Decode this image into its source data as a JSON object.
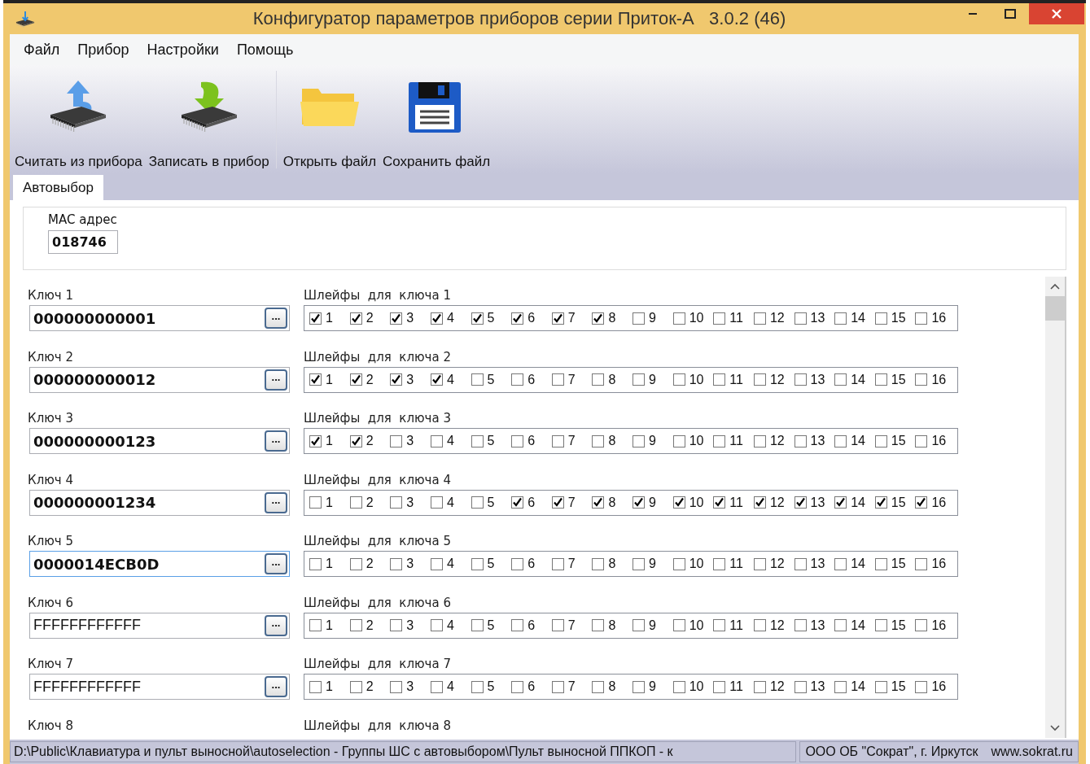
{
  "window": {
    "title": "Конфигуратор параметров приборов серии Приток-А   3.0.2 (46)"
  },
  "menu": [
    "Файл",
    "Прибор",
    "Настройки",
    "Помощь"
  ],
  "toolbar": [
    {
      "kind": "read",
      "label": "Считать из прибора"
    },
    {
      "kind": "write",
      "label": "Записать в прибор"
    },
    {
      "kind": "open",
      "label": "Открыть файл"
    },
    {
      "kind": "save",
      "label": "Сохранить файл"
    }
  ],
  "tabs": [
    {
      "label": "Автовыбор",
      "selected": true
    }
  ],
  "mac": {
    "label": "MAC адрес",
    "value": "018746"
  },
  "keys": [
    {
      "label": "Ключ 1",
      "value": "000000000001",
      "assigned": true,
      "focused": false,
      "button": "...",
      "loops_title": "Шлейфы  для  ключа 1",
      "loops": [
        {
          "label": "1",
          "checked": true
        },
        {
          "label": "2",
          "checked": true
        },
        {
          "label": "3",
          "checked": true
        },
        {
          "label": "4",
          "checked": true
        },
        {
          "label": "5",
          "checked": true
        },
        {
          "label": "6",
          "checked": true
        },
        {
          "label": "7",
          "checked": true
        },
        {
          "label": "8",
          "checked": true
        },
        {
          "label": "9",
          "checked": false
        },
        {
          "label": "10",
          "checked": false
        },
        {
          "label": "11",
          "checked": false
        },
        {
          "label": "12",
          "checked": false
        },
        {
          "label": "13",
          "checked": false
        },
        {
          "label": "14",
          "checked": false
        },
        {
          "label": "15",
          "checked": false
        },
        {
          "label": "16",
          "checked": false
        }
      ]
    },
    {
      "label": "Ключ 2",
      "value": "000000000012",
      "assigned": true,
      "focused": false,
      "button": "...",
      "loops_title": "Шлейфы  для  ключа 2",
      "loops": [
        {
          "label": "1",
          "checked": true
        },
        {
          "label": "2",
          "checked": true
        },
        {
          "label": "3",
          "checked": true
        },
        {
          "label": "4",
          "checked": true
        },
        {
          "label": "5",
          "checked": false
        },
        {
          "label": "6",
          "checked": false
        },
        {
          "label": "7",
          "checked": false
        },
        {
          "label": "8",
          "checked": false
        },
        {
          "label": "9",
          "checked": false
        },
        {
          "label": "10",
          "checked": false
        },
        {
          "label": "11",
          "checked": false
        },
        {
          "label": "12",
          "checked": false
        },
        {
          "label": "13",
          "checked": false
        },
        {
          "label": "14",
          "checked": false
        },
        {
          "label": "15",
          "checked": false
        },
        {
          "label": "16",
          "checked": false
        }
      ]
    },
    {
      "label": "Ключ 3",
      "value": "000000000123",
      "assigned": true,
      "focused": false,
      "button": "...",
      "loops_title": "Шлейфы  для  ключа 3",
      "loops": [
        {
          "label": "1",
          "checked": true
        },
        {
          "label": "2",
          "checked": true
        },
        {
          "label": "3",
          "checked": false
        },
        {
          "label": "4",
          "checked": false
        },
        {
          "label": "5",
          "checked": false
        },
        {
          "label": "6",
          "checked": false
        },
        {
          "label": "7",
          "checked": false
        },
        {
          "label": "8",
          "checked": false
        },
        {
          "label": "9",
          "checked": false
        },
        {
          "label": "10",
          "checked": false
        },
        {
          "label": "11",
          "checked": false
        },
        {
          "label": "12",
          "checked": false
        },
        {
          "label": "13",
          "checked": false
        },
        {
          "label": "14",
          "checked": false
        },
        {
          "label": "15",
          "checked": false
        },
        {
          "label": "16",
          "checked": false
        }
      ]
    },
    {
      "label": "Ключ 4",
      "value": "000000001234",
      "assigned": true,
      "focused": false,
      "button": "...",
      "loops_title": "Шлейфы  для  ключа 4",
      "loops": [
        {
          "label": "1",
          "checked": false
        },
        {
          "label": "2",
          "checked": false
        },
        {
          "label": "3",
          "checked": false
        },
        {
          "label": "4",
          "checked": false
        },
        {
          "label": "5",
          "checked": false
        },
        {
          "label": "6",
          "checked": true
        },
        {
          "label": "7",
          "checked": true
        },
        {
          "label": "8",
          "checked": true
        },
        {
          "label": "9",
          "checked": true
        },
        {
          "label": "10",
          "checked": true
        },
        {
          "label": "11",
          "checked": true
        },
        {
          "label": "12",
          "checked": true
        },
        {
          "label": "13",
          "checked": true
        },
        {
          "label": "14",
          "checked": true
        },
        {
          "label": "15",
          "checked": true
        },
        {
          "label": "16",
          "checked": true
        }
      ]
    },
    {
      "label": "Ключ 5",
      "value": "0000014ECB0D",
      "assigned": true,
      "focused": true,
      "button": "...",
      "loops_title": "Шлейфы  для  ключа 5",
      "loops": [
        {
          "label": "1",
          "checked": false
        },
        {
          "label": "2",
          "checked": false
        },
        {
          "label": "3",
          "checked": false
        },
        {
          "label": "4",
          "checked": false
        },
        {
          "label": "5",
          "checked": false
        },
        {
          "label": "6",
          "checked": false
        },
        {
          "label": "7",
          "checked": false
        },
        {
          "label": "8",
          "checked": false
        },
        {
          "label": "9",
          "checked": false
        },
        {
          "label": "10",
          "checked": false
        },
        {
          "label": "11",
          "checked": false
        },
        {
          "label": "12",
          "checked": false
        },
        {
          "label": "13",
          "checked": false
        },
        {
          "label": "14",
          "checked": false
        },
        {
          "label": "15",
          "checked": false
        },
        {
          "label": "16",
          "checked": false
        }
      ]
    },
    {
      "label": "Ключ 6",
      "value": "FFFFFFFFFFFF",
      "assigned": false,
      "focused": false,
      "button": "...",
      "loops_title": "Шлейфы  для  ключа 6",
      "loops": [
        {
          "label": "1",
          "checked": false
        },
        {
          "label": "2",
          "checked": false
        },
        {
          "label": "3",
          "checked": false
        },
        {
          "label": "4",
          "checked": false
        },
        {
          "label": "5",
          "checked": false
        },
        {
          "label": "6",
          "checked": false
        },
        {
          "label": "7",
          "checked": false
        },
        {
          "label": "8",
          "checked": false
        },
        {
          "label": "9",
          "checked": false
        },
        {
          "label": "10",
          "checked": false
        },
        {
          "label": "11",
          "checked": false
        },
        {
          "label": "12",
          "checked": false
        },
        {
          "label": "13",
          "checked": false
        },
        {
          "label": "14",
          "checked": false
        },
        {
          "label": "15",
          "checked": false
        },
        {
          "label": "16",
          "checked": false
        }
      ]
    },
    {
      "label": "Ключ 7",
      "value": "FFFFFFFFFFFF",
      "assigned": false,
      "focused": false,
      "button": "...",
      "loops_title": "Шлейфы  для  ключа 7",
      "loops": [
        {
          "label": "1",
          "checked": false
        },
        {
          "label": "2",
          "checked": false
        },
        {
          "label": "3",
          "checked": false
        },
        {
          "label": "4",
          "checked": false
        },
        {
          "label": "5",
          "checked": false
        },
        {
          "label": "6",
          "checked": false
        },
        {
          "label": "7",
          "checked": false
        },
        {
          "label": "8",
          "checked": false
        },
        {
          "label": "9",
          "checked": false
        },
        {
          "label": "10",
          "checked": false
        },
        {
          "label": "11",
          "checked": false
        },
        {
          "label": "12",
          "checked": false
        },
        {
          "label": "13",
          "checked": false
        },
        {
          "label": "14",
          "checked": false
        },
        {
          "label": "15",
          "checked": false
        },
        {
          "label": "16",
          "checked": false
        }
      ]
    },
    {
      "label": "Ключ 8",
      "loops_title": "Шлейфы  для  ключа 8"
    }
  ],
  "status_bar": {
    "path": "D:\\Public\\Клавиатура и пульт выносной\\autoselection - Группы ШС с автовыбором\\Пульт выносной ППКОП - к",
    "company": "ООО ОБ \"Сократ\", г. Иркутск",
    "website": "www.sokrat.ru"
  }
}
